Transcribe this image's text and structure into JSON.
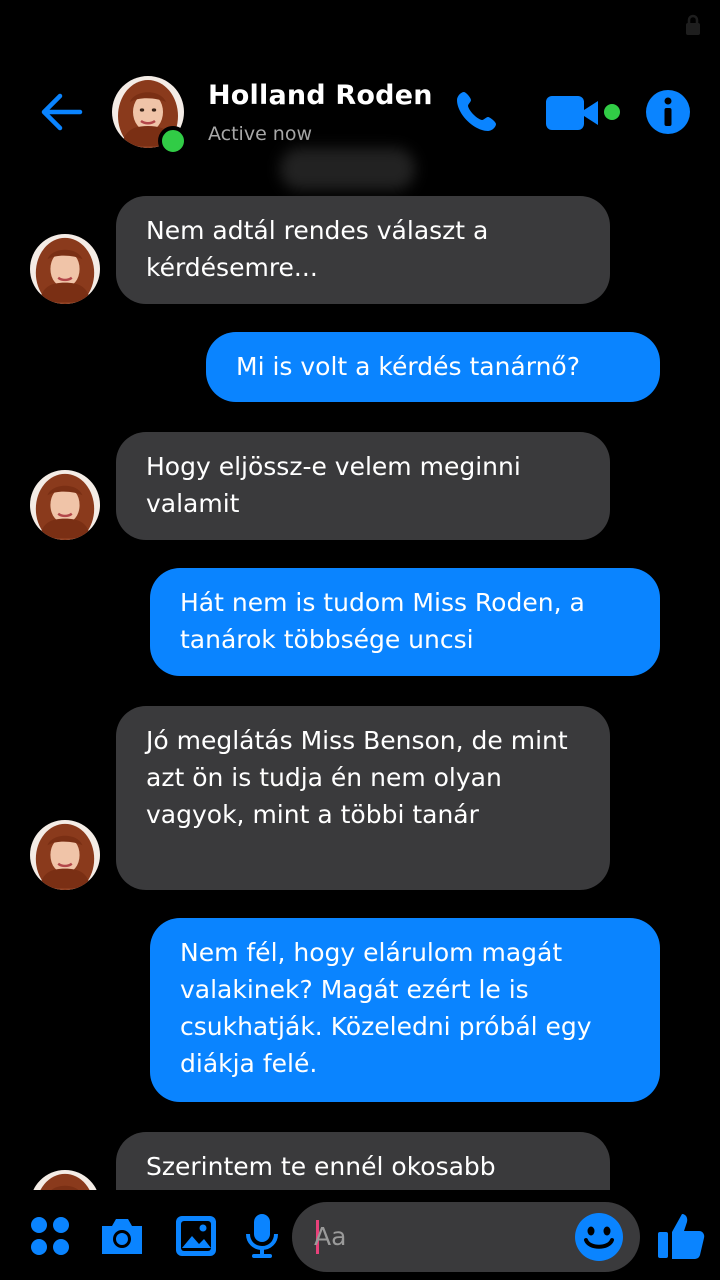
{
  "header": {
    "contact_name": "Holland Roden",
    "status": "Active now"
  },
  "messages": [
    {
      "id": "m1",
      "sender": "contact",
      "text": "Nem adtál rendes választ a kérdésemre..."
    },
    {
      "id": "m2",
      "sender": "me",
      "text": "Mi is volt a kérdés tanárnő?"
    },
    {
      "id": "m3",
      "sender": "contact",
      "text": "Hogy eljössz-e velem meginni valamit"
    },
    {
      "id": "m4",
      "sender": "me",
      "text": "Hát nem is tudom Miss Roden, a tanárok többsége uncsi"
    },
    {
      "id": "m5",
      "sender": "contact",
      "text": "Jó meglátás Miss Benson, de mint azt ön is tudja én nem olyan vagyok, mint a többi tanár"
    },
    {
      "id": "m6",
      "sender": "me",
      "text": "Nem fél, hogy elárulom magát valakinek? Magát ezért le is csukhatják. Közeledni próbál egy diákja felé."
    },
    {
      "id": "m7",
      "sender": "contact",
      "text": "Szerintem te ennél okosabb"
    }
  ],
  "composer": {
    "placeholder": "Aa"
  },
  "colors": {
    "accent": "#0a84ff",
    "incoming_bubble": "#3a3a3c",
    "background": "#000000",
    "online": "#31cc46"
  },
  "icons": [
    "back-arrow-icon",
    "phone-icon",
    "video-camera-icon",
    "info-icon",
    "apps-grid-icon",
    "camera-icon",
    "gallery-icon",
    "microphone-icon",
    "emoji-icon",
    "thumbs-up-icon",
    "lock-icon"
  ]
}
